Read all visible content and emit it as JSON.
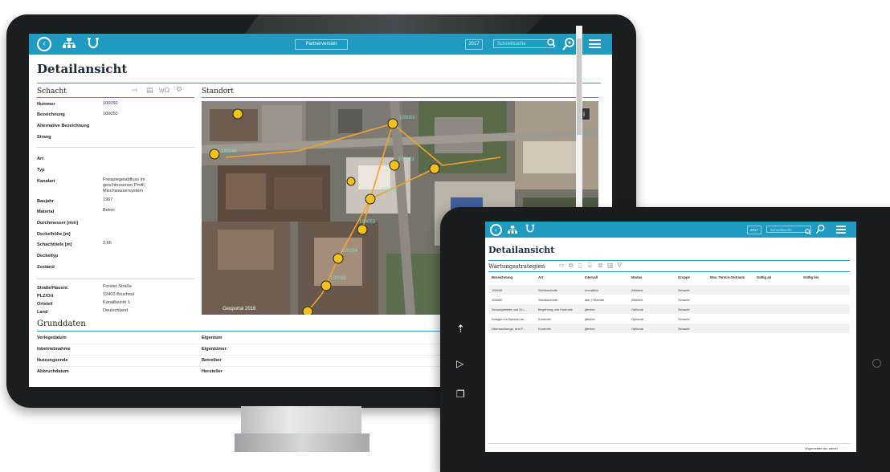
{
  "monitor": {
    "header": {
      "partner_button": "Partnerversion",
      "year": "2017",
      "search_placeholder": "Schnellsuche"
    },
    "page_title": "Detailansicht",
    "schacht": {
      "title": "Schacht",
      "fields_a": [
        {
          "label": "Nummer",
          "value": "100050"
        },
        {
          "label": "Bezeichnung",
          "value": "100050"
        },
        {
          "label": "Alternative Bezeichnung",
          "value": ""
        },
        {
          "label": "Strang",
          "value": ""
        }
      ],
      "fields_b": [
        {
          "label": "Art",
          "value": ""
        },
        {
          "label": "Typ",
          "value": ""
        },
        {
          "label": "Kanalart",
          "value": "Freispiegelabfluss im geschlossenen Profil, Mischwassersystem"
        },
        {
          "label": "Baujahr",
          "value": "1967"
        },
        {
          "label": "Material",
          "value": "Beton"
        },
        {
          "label": "Durchmesser [mm]",
          "value": ""
        },
        {
          "label": "Deckelhöhe [m]",
          "value": ""
        },
        {
          "label": "Schachttiefe [m]",
          "value": "2,66"
        },
        {
          "label": "Deckeltyp",
          "value": ""
        },
        {
          "label": "Zustand",
          "value": ""
        }
      ],
      "fields_c": [
        {
          "label": "Straße/Hausnr.",
          "value": "Forster Straße"
        },
        {
          "label": "PLZ/Ort",
          "value": "12403 Bruchsal"
        },
        {
          "label": "Ortsteil",
          "value": "Kanalbezirk 1"
        },
        {
          "label": "Land",
          "value": "Deutschland"
        }
      ]
    },
    "standort": {
      "title": "Standort",
      "map_copyright": "Geoportal 2016",
      "map_info": "i"
    },
    "grunddaten": {
      "title": "Grunddaten",
      "left": [
        "Verlegedatum",
        "Inbetriebnahme",
        "Nutzungsende",
        "Abbruchdatum"
      ],
      "right": [
        "Eigentum",
        "Eigentümer",
        "Betreiber",
        "Hersteller"
      ]
    }
  },
  "tablet": {
    "header": {
      "year": "2017",
      "search_placeholder": "Schnellsuche"
    },
    "page_title": "Detailansicht",
    "section_title": "Wartungsstrategien",
    "columns": [
      "Bezeichnung",
      "Art",
      "Intervall",
      "Modus",
      "Gruppe",
      "Max. Termin-Zeitraum",
      "Gültig ab",
      "Gültig bis"
    ],
    "rows": [
      [
        "100040",
        "Sichtkontrolle",
        "monatlich",
        "Aktiviert",
        "Schacht",
        "",
        "",
        ""
      ],
      [
        "100050",
        "Sichtkontrolle",
        "alle 2 Monate",
        "Aktiviert",
        "Schacht",
        "",
        "",
        ""
      ],
      [
        "Schutzgebiete und Gu...",
        "Begehung und Kontrolle",
        "jährlich",
        "Optional",
        "Schacht",
        "",
        "",
        ""
      ],
      [
        "Anlagen im Bereich de...",
        "Kontrolle",
        "jährlich",
        "Optional",
        "Schacht",
        "",
        "",
        ""
      ],
      [
        "Überwachungs- und F...",
        "Kontrolle",
        "jährlich",
        "Optional",
        "Schacht",
        "",
        "",
        ""
      ]
    ],
    "footer_user": "Angemeldet als: admin"
  }
}
